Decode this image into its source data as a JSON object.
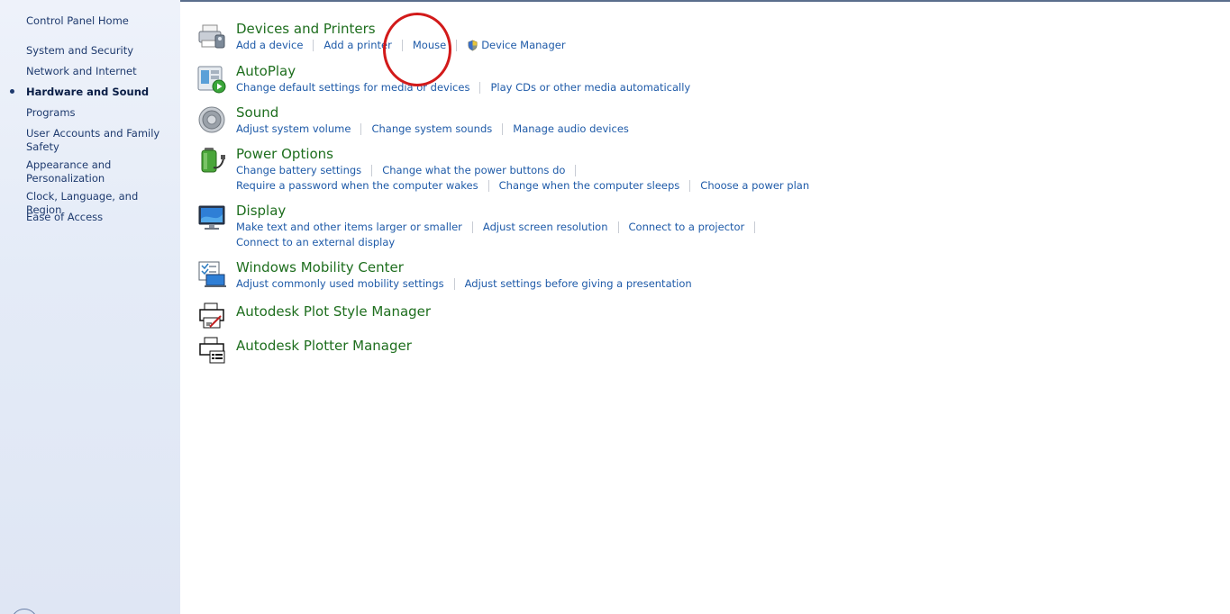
{
  "sidebar": {
    "home": "Control Panel Home",
    "items": [
      {
        "label": "System and Security"
      },
      {
        "label": "Network and Internet"
      },
      {
        "label": "Hardware and Sound"
      },
      {
        "label": "Programs"
      },
      {
        "label": "User Accounts and Family Safety"
      },
      {
        "label": "Appearance and Personalization"
      },
      {
        "label": "Clock, Language, and Region"
      },
      {
        "label": "Ease of Access"
      }
    ],
    "active_item": "Hardware and Sound"
  },
  "categories": [
    {
      "title": "Devices and Printers",
      "icon": "printer-icon",
      "links": [
        "Add a device",
        "Add a printer",
        "Mouse",
        "Device Manager"
      ]
    },
    {
      "title": "AutoPlay",
      "icon": "autoplay-icon",
      "links": [
        "Change default settings for media or devices",
        "Play CDs or other media automatically"
      ]
    },
    {
      "title": "Sound",
      "icon": "speaker-icon",
      "links": [
        "Adjust system volume",
        "Change system sounds",
        "Manage audio devices"
      ]
    },
    {
      "title": "Power Options",
      "icon": "battery-icon",
      "links": [
        "Change battery settings",
        "Change what the power buttons do",
        "Require a password when the computer wakes",
        "Change when the computer sleeps",
        "Choose a power plan"
      ]
    },
    {
      "title": "Display",
      "icon": "monitor-icon",
      "links": [
        "Make text and other items larger or smaller",
        "Adjust screen resolution",
        "Connect to a projector",
        "Connect to an external display"
      ]
    },
    {
      "title": "Windows Mobility Center",
      "icon": "mobility-center-icon",
      "links": [
        "Adjust commonly used mobility settings",
        "Adjust settings before giving a presentation"
      ]
    },
    {
      "title": "Autodesk Plot Style Manager",
      "icon": "plot-style-icon",
      "links": []
    },
    {
      "title": "Autodesk Plotter Manager",
      "icon": "plotter-icon",
      "links": []
    }
  ],
  "annotation": {
    "highlighted_item": "Mouse",
    "color": "#d21a1a"
  },
  "colors": {
    "title": "#1e6e1e",
    "link": "#1e5aa8",
    "sidebar_bg": "#e4ebf7"
  }
}
